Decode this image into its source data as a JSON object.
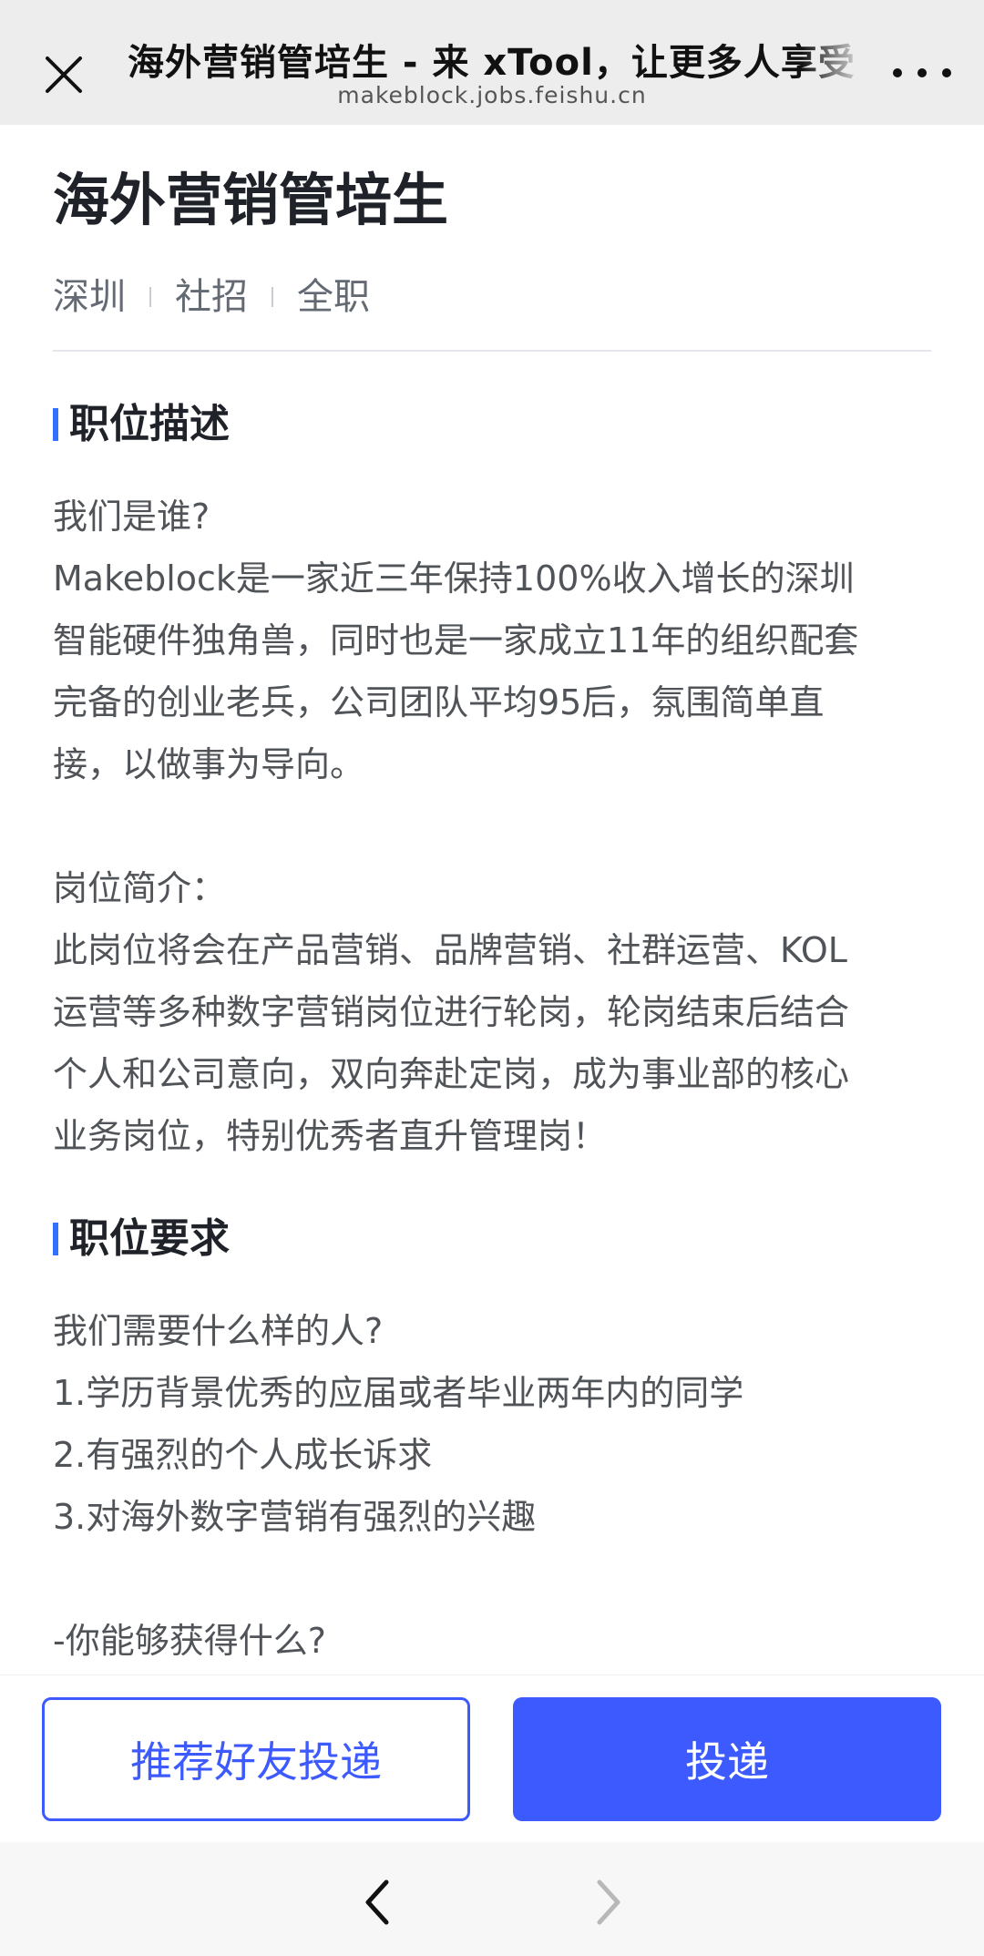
{
  "header": {
    "title": "海外营销管培生 - 来 xTool，让更多人享受",
    "domain": "makeblock.jobs.feishu.cn"
  },
  "job": {
    "title": "海外营销管培生",
    "meta": [
      "深圳",
      "社招",
      "全职"
    ]
  },
  "sections": {
    "description": {
      "heading": "职位描述",
      "lines": [
        "我们是谁?",
        "Makeblock是一家近三年保持100%收入增长的深圳",
        "智能硬件独角兽，同时也是一家成立11年的组织配套",
        "完备的创业老兵，公司团队平均95后，氛围简单直",
        "接，以做事为导向。",
        "",
        "岗位简介：",
        "此岗位将会在产品营销、品牌营销、社群运营、KOL",
        "运营等多种数字营销岗位进行轮岗，轮岗结束后结合",
        "个人和公司意向，双向奔赴定岗，成为事业部的核心",
        "业务岗位，特别优秀者直升管理岗！"
      ]
    },
    "requirements": {
      "heading": "职位要求",
      "lines": [
        "我们需要什么样的人?",
        "1.学历背景优秀的应届或者毕业两年内的同学",
        "2.有强烈的个人成长诉求",
        "3.对海外数字营销有强烈的兴趣",
        "",
        "-你能够获得什么?"
      ]
    }
  },
  "actions": {
    "recommend_label": "推荐好友投递",
    "apply_label": "投递"
  },
  "icons": {
    "close": "close-icon",
    "more": "more-icon",
    "back": "chevron-left-icon",
    "forward": "chevron-right-icon"
  },
  "colors": {
    "accent": "#3d5afe",
    "section_bar": "#3370ff"
  }
}
